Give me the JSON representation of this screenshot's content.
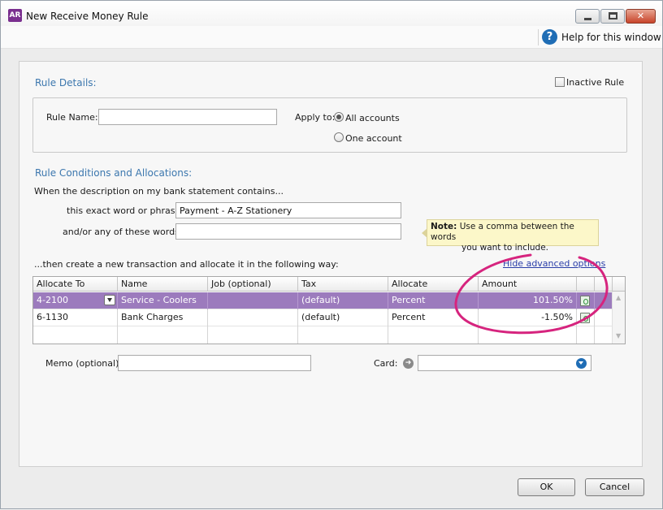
{
  "window": {
    "app_icon": "AR",
    "title": "New Receive Money Rule",
    "controls": {
      "minimize": "minimize-icon",
      "maximize": "maximize-icon",
      "close": "close-icon",
      "close_glyph": "✕"
    }
  },
  "helpbar": {
    "icon_glyph": "?",
    "label": "Help for this window"
  },
  "rule_details": {
    "section_title": "Rule Details:",
    "inactive_label": "Inactive Rule",
    "inactive_checked": false,
    "rule_name_label": "Rule Name:",
    "rule_name_value": "",
    "apply_to_label": "Apply to:",
    "apply_options": [
      {
        "label": "All accounts",
        "selected": true
      },
      {
        "label": "One account",
        "selected": false
      }
    ]
  },
  "conditions": {
    "section_title": "Rule Conditions and Allocations:",
    "intro": "When the description on my bank statement contains...",
    "exact_label": "this exact word or phrase:",
    "exact_value": "Payment - A-Z Stationery",
    "any_label": "and/or any of these words:",
    "any_value": "",
    "note_title": "Note:",
    "note_line1": "Use a comma between the words",
    "note_line2": "you want to include."
  },
  "allocation": {
    "intro": "...then create a new transaction and allocate it in the following way:",
    "advanced_link": "Hide advanced options",
    "columns": [
      "Allocate To",
      "Name",
      "Job (optional)",
      "Tax",
      "Allocate",
      "Amount"
    ],
    "rows": [
      {
        "account": "4-2100",
        "name": "Service - Coolers",
        "job": "",
        "tax": "(default)",
        "allocate": "Percent",
        "amount": "101.50%",
        "selected": true
      },
      {
        "account": "6-1130",
        "name": "Bank Charges",
        "job": "",
        "tax": "(default)",
        "allocate": "Percent",
        "amount": "-1.50%",
        "selected": false
      }
    ],
    "scroll_up": "▲",
    "scroll_down": "▼"
  },
  "memo": {
    "label": "Memo (optional):",
    "value": ""
  },
  "card": {
    "label": "Card:",
    "arrow_glyph": "➜",
    "value": ""
  },
  "buttons": {
    "ok": "OK",
    "cancel": "Cancel"
  },
  "colors": {
    "selected_row": "#9c7bbd",
    "section_title": "#3c77ae",
    "annotation": "#d6247e",
    "help_icon": "#1f6db5"
  }
}
